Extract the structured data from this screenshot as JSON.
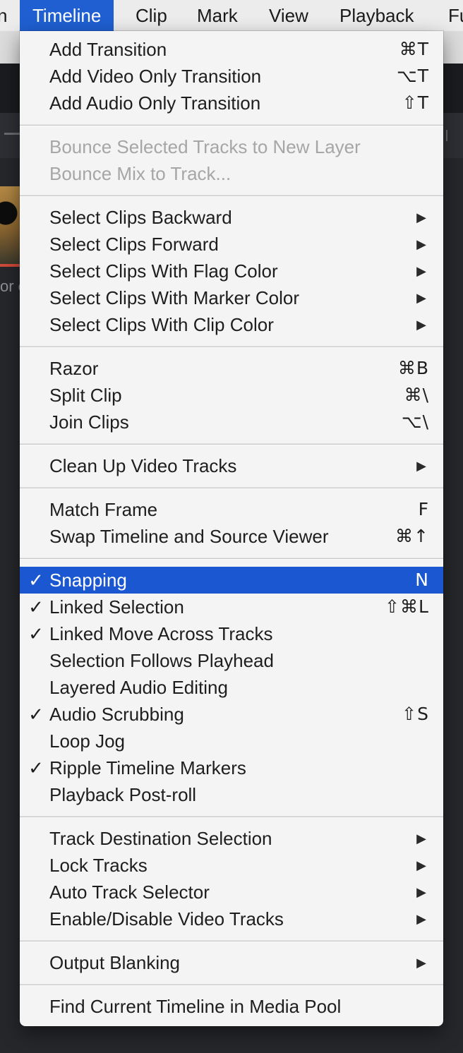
{
  "menubar": {
    "items": [
      {
        "label": "n",
        "active": false
      },
      {
        "label": "Timeline",
        "active": true
      },
      {
        "label": "Clip",
        "active": false
      },
      {
        "label": "Mark",
        "active": false
      },
      {
        "label": "View",
        "active": false
      },
      {
        "label": "Playback",
        "active": false
      },
      {
        "label": "Fu",
        "active": false
      }
    ]
  },
  "background": {
    "clip_name_fragment": "or c"
  },
  "menu": {
    "sections": [
      {
        "items": [
          {
            "label": "Add Transition",
            "shortcut": "⌘T"
          },
          {
            "label": "Add Video Only Transition",
            "shortcut": "⌥T"
          },
          {
            "label": "Add Audio Only Transition",
            "shortcut": "⇧T"
          }
        ]
      },
      {
        "items": [
          {
            "label": "Bounce Selected Tracks to New Layer",
            "disabled": true
          },
          {
            "label": "Bounce Mix to Track...",
            "disabled": true
          }
        ]
      },
      {
        "items": [
          {
            "label": "Select Clips Backward",
            "submenu": true
          },
          {
            "label": "Select Clips Forward",
            "submenu": true
          },
          {
            "label": "Select Clips With Flag Color",
            "submenu": true
          },
          {
            "label": "Select Clips With Marker Color",
            "submenu": true
          },
          {
            "label": "Select Clips With Clip Color",
            "submenu": true
          }
        ]
      },
      {
        "items": [
          {
            "label": "Razor",
            "shortcut": "⌘B"
          },
          {
            "label": "Split Clip",
            "shortcut": "⌘\\"
          },
          {
            "label": "Join Clips",
            "shortcut": "⌥\\"
          }
        ]
      },
      {
        "items": [
          {
            "label": "Clean Up Video Tracks",
            "submenu": true
          }
        ]
      },
      {
        "items": [
          {
            "label": "Match Frame",
            "shortcut": "F"
          },
          {
            "label": "Swap Timeline and Source Viewer",
            "shortcut": "⌘↑"
          }
        ]
      },
      {
        "items": [
          {
            "label": "Snapping",
            "shortcut": "N",
            "checked": true,
            "highlighted": true
          },
          {
            "label": "Linked Selection",
            "shortcut": "⇧⌘L",
            "checked": true
          },
          {
            "label": "Linked Move Across Tracks",
            "checked": true
          },
          {
            "label": "Selection Follows Playhead"
          },
          {
            "label": "Layered Audio Editing"
          },
          {
            "label": "Audio Scrubbing",
            "shortcut": "⇧S",
            "checked": true
          },
          {
            "label": "Loop Jog"
          },
          {
            "label": "Ripple Timeline Markers",
            "checked": true
          },
          {
            "label": "Playback Post-roll"
          }
        ]
      },
      {
        "items": [
          {
            "label": "Track Destination Selection",
            "submenu": true
          },
          {
            "label": "Lock Tracks",
            "submenu": true
          },
          {
            "label": "Auto Track Selector",
            "submenu": true
          },
          {
            "label": "Enable/Disable Video Tracks",
            "submenu": true
          }
        ]
      },
      {
        "items": [
          {
            "label": "Output Blanking",
            "submenu": true
          }
        ]
      },
      {
        "items": [
          {
            "label": "Find Current Timeline in Media Pool"
          }
        ]
      }
    ],
    "checkmark_glyph": "✓",
    "submenu_glyph": "▶"
  },
  "colors": {
    "highlight": "#1b57d0",
    "menu_background": "#f4f4f4",
    "disabled_text": "#a6a6a6"
  }
}
